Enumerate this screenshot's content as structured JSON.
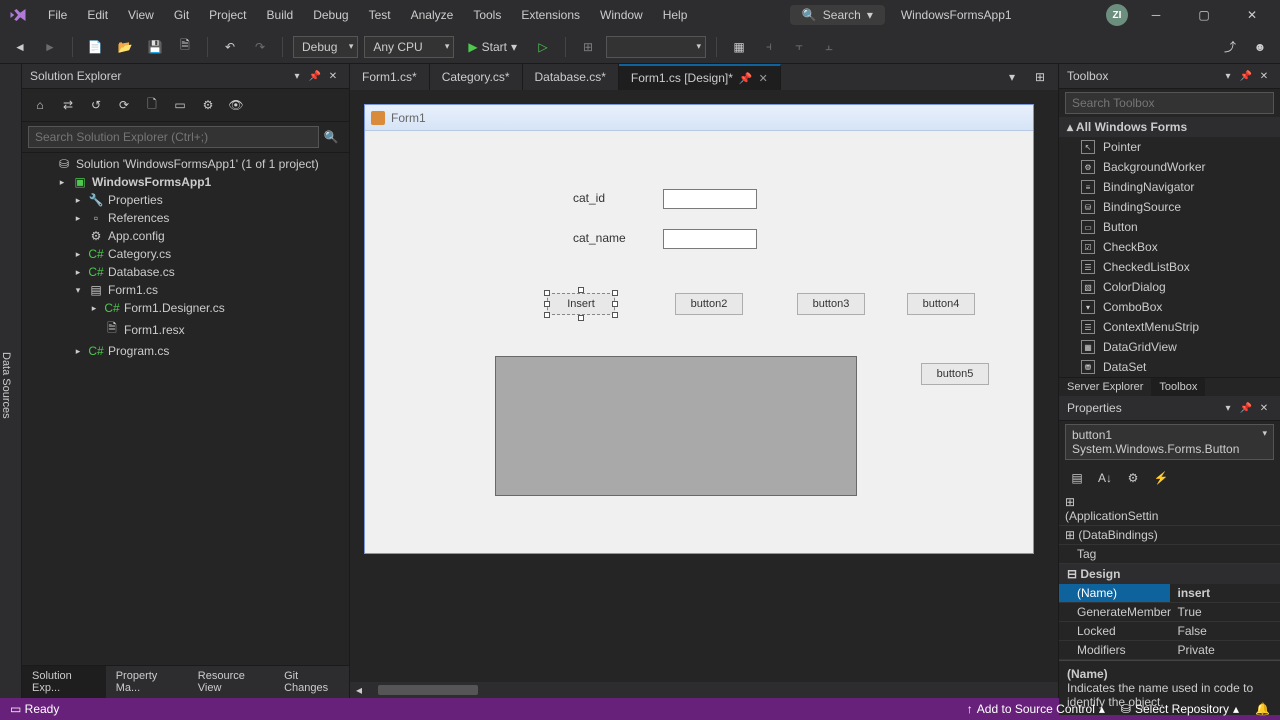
{
  "titlebar": {
    "menu": [
      "File",
      "Edit",
      "View",
      "Git",
      "Project",
      "Build",
      "Debug",
      "Test",
      "Analyze",
      "Tools",
      "Extensions",
      "Window",
      "Help"
    ],
    "search_label": "Search",
    "app_title": "WindowsFormsApp1",
    "avatar_initials": "ZI"
  },
  "toolbar": {
    "config": "Debug",
    "platform": "Any CPU",
    "start_label": "Start"
  },
  "left_strip": {
    "label": "Data Sources"
  },
  "solution_explorer": {
    "title": "Solution Explorer",
    "search_placeholder": "Search Solution Explorer (Ctrl+;)",
    "root": "Solution 'WindowsFormsApp1' (1 of 1 project)",
    "project": "WindowsFormsApp1",
    "items": {
      "properties": "Properties",
      "references": "References",
      "appconfig": "App.config",
      "category": "Category.cs",
      "database": "Database.cs",
      "form1": "Form1.cs",
      "form1_designer": "Form1.Designer.cs",
      "form1_resx": "Form1.resx",
      "program": "Program.cs"
    },
    "bottom_tabs": [
      "Solution Exp...",
      "Property Ma...",
      "Resource View",
      "Git Changes"
    ]
  },
  "editor": {
    "tabs": [
      {
        "label": "Form1.cs*",
        "active": false
      },
      {
        "label": "Category.cs*",
        "active": false
      },
      {
        "label": "Database.cs*",
        "active": false
      },
      {
        "label": "Form1.cs [Design]*",
        "active": true
      }
    ],
    "form": {
      "title": "Form1",
      "labels": {
        "cat_id": "cat_id",
        "cat_name": "cat_name"
      },
      "buttons": {
        "insert": "Insert",
        "b2": "button2",
        "b3": "button3",
        "b4": "button4",
        "b5": "button5"
      }
    }
  },
  "toolbox": {
    "title": "Toolbox",
    "search_placeholder": "Search Toolbox",
    "group": "All Windows Forms",
    "items": [
      "Pointer",
      "BackgroundWorker",
      "BindingNavigator",
      "BindingSource",
      "Button",
      "CheckBox",
      "CheckedListBox",
      "ColorDialog",
      "ComboBox",
      "ContextMenuStrip",
      "DataGridView",
      "DataSet"
    ],
    "bottom_tabs": [
      "Server Explorer",
      "Toolbox"
    ]
  },
  "properties": {
    "title": "Properties",
    "object": "button1  System.Windows.Forms.Button",
    "categories": {
      "app": "(ApplicationSettin",
      "data": "(DataBindings)",
      "tag_k": "Tag",
      "design": "Design",
      "name_k": "(Name)",
      "name_v": "insert",
      "gen_k": "GenerateMember",
      "gen_v": "True",
      "lock_k": "Locked",
      "lock_v": "False",
      "mod_k": "Modifiers",
      "mod_v": "Private"
    },
    "help_name": "(Name)",
    "help_text": "Indicates the name used in code to identify the object."
  },
  "statusbar": {
    "ready": "Ready",
    "add_source": "Add to Source Control",
    "select_repo": "Select Repository"
  }
}
